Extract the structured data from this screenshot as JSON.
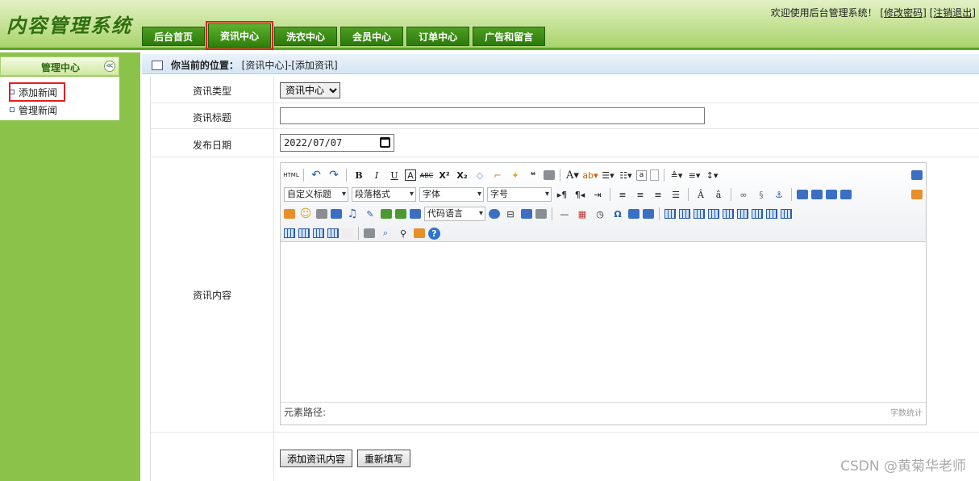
{
  "header": {
    "app_title": "内容管理系统",
    "welcome_text": "欢迎使用后台管理系统！",
    "change_password": "[修改密码]",
    "logout": "[注销退出]"
  },
  "nav": {
    "tabs": [
      {
        "label": "后台首页"
      },
      {
        "label": "资讯中心",
        "active": true
      },
      {
        "label": "洗衣中心"
      },
      {
        "label": "会员中心"
      },
      {
        "label": "订单中心"
      },
      {
        "label": "广告和留言"
      }
    ]
  },
  "sidebar": {
    "title": "管理中心",
    "collapse_glyph": "≪",
    "items": [
      {
        "label": "添加新闻",
        "highlighted": true
      },
      {
        "label": "管理新闻"
      }
    ]
  },
  "breadcrumb": {
    "label": "你当前的位置：",
    "path": "[资讯中心]-[添加资讯]"
  },
  "form": {
    "type_label": "资讯类型",
    "type_value": "资讯中心",
    "title_label": "资讯标题",
    "title_value": "",
    "date_label": "发布日期",
    "date_value": "2022/07/07",
    "content_label": "资讯内容",
    "editor": {
      "combo_heading": "自定义标题",
      "combo_paragraph": "段落格式",
      "combo_font": "字体",
      "combo_size": "字号",
      "combo_code": "代码语言",
      "element_path": "元素路径:",
      "word_count": "字数统计"
    },
    "submit_label": "添加资讯内容",
    "reset_label": "重新填写"
  },
  "watermark": "CSDN @黄菊华老师",
  "colors": {
    "nav_green": "#2c7a0b",
    "sidebar_green": "#8bc34a",
    "highlight_red": "#e02020"
  }
}
